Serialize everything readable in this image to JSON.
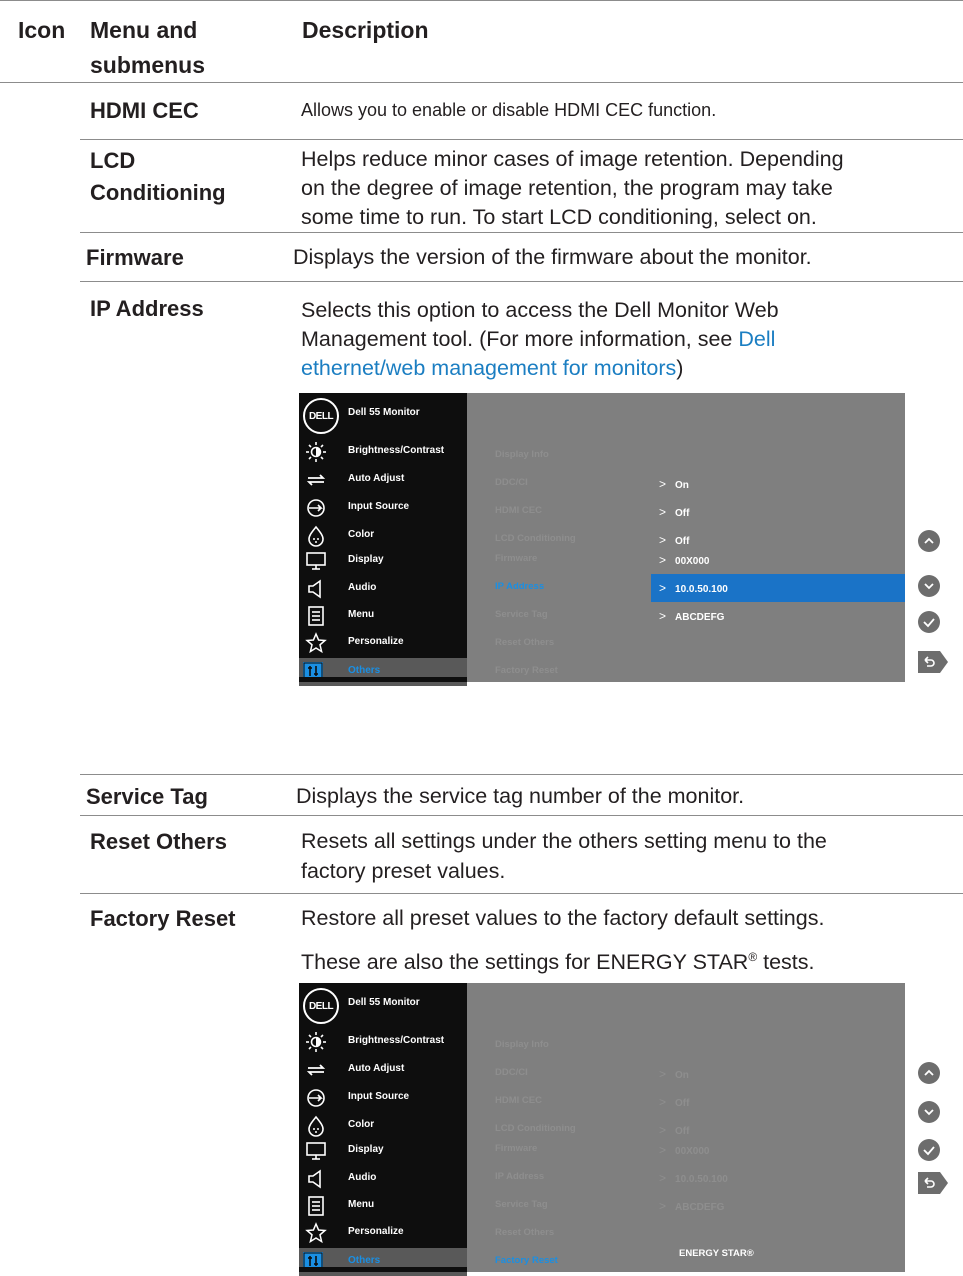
{
  "header": {
    "icon": "Icon",
    "menu": "Menu and",
    "menu2": "submenus",
    "description": "Description"
  },
  "rows": [
    {
      "term": "HDMI CEC",
      "desc": "Allows you to enable or disable HDMI CEC function."
    },
    {
      "term1": "LCD",
      "term2": "Conditioning",
      "l1": "Helps reduce minor cases of image retention. Depending",
      "l2": "on the degree of image retention, the program may take",
      "l3": "some time to run. To start LCD conditioning, select on."
    },
    {
      "term": "Firmware",
      "desc": "Displays the version of the firmware about the monitor."
    },
    {
      "term": "IP Address",
      "l1": "Selects this option to access the Dell Monitor Web",
      "l2a": "Management tool. (For more information, see ",
      "l2link": "Dell",
      "l3link": "ethernet/web management for monitors",
      "l3b": ")"
    },
    {
      "term": "Service Tag",
      "desc": "Displays the service tag number of the monitor."
    },
    {
      "term": "Reset Others",
      "l1": "Resets all settings under the others setting menu to the",
      "l2": "factory preset values."
    },
    {
      "term": "Factory Reset",
      "l1": "Restore all preset values to the factory default settings.",
      "l2a": "These are also the settings for ENERGY STAR",
      "l2sup": "®",
      "l2b": " tests."
    }
  ],
  "osd": {
    "logo": "DELL",
    "title": "Dell 55 Monitor",
    "menu": [
      "Brightness/Contrast",
      "Auto Adjust",
      "Input Source",
      "Color",
      "Display",
      "Audio",
      "Menu",
      "Personalize",
      "Others"
    ],
    "menu_icons": [
      "brightness-icon",
      "auto-adjust-icon",
      "input-source-icon",
      "color-icon",
      "display-icon",
      "audio-icon",
      "menu-icon",
      "personalize-icon",
      "others-icon"
    ],
    "submenu": [
      "Display Info",
      "DDC/CI",
      "HDMI CEC",
      "LCD Conditioning",
      "Firmware",
      "IP Address",
      "Service Tag",
      "Reset Others",
      "Factory Reset"
    ],
    "values": [
      "On",
      "Off",
      "Off",
      "00X000",
      "10.0.50.100",
      "ABCDEFG"
    ],
    "energy_star": "ENERGY STAR®",
    "chevron": ">"
  },
  "colors": {
    "link": "#1b7ec2",
    "highlight": "#1a73c7",
    "osd_bg": "#7f7f7f"
  }
}
